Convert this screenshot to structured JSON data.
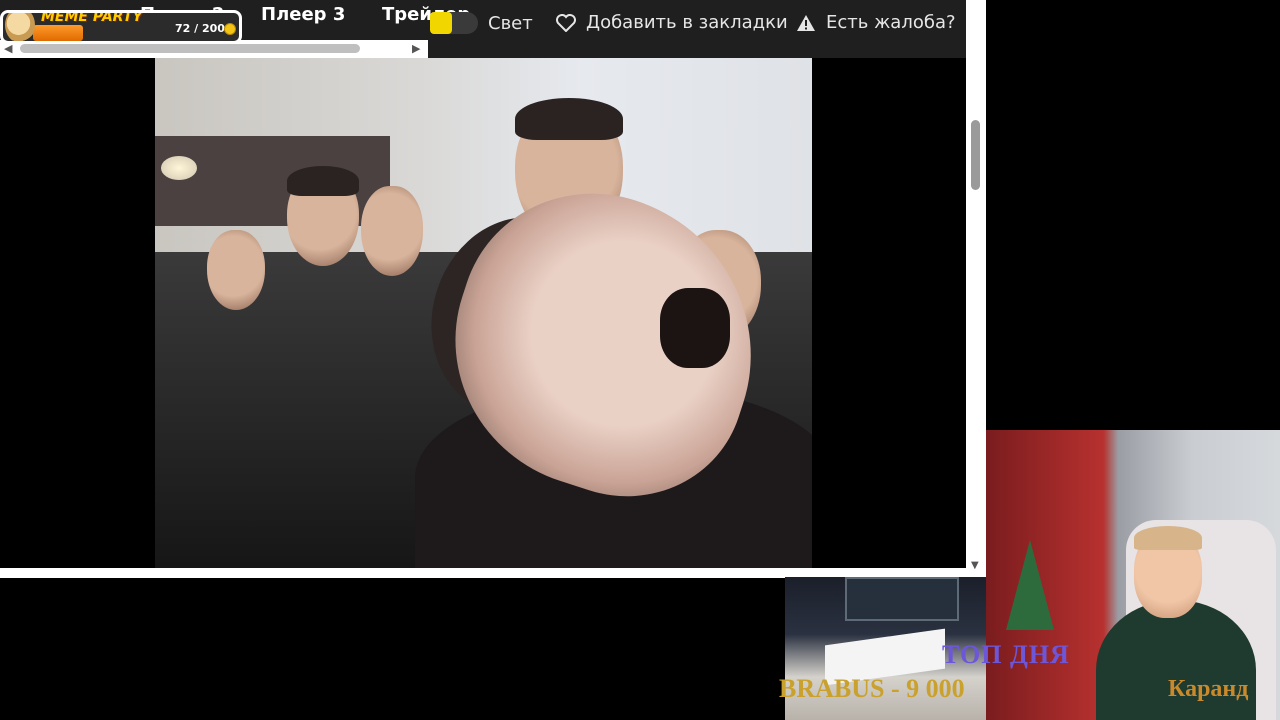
{
  "tabs": [
    {
      "label": "Плеер 2"
    },
    {
      "label": "Плеер 3"
    },
    {
      "label": "Трейлер"
    }
  ],
  "toolbar": {
    "light_label": "Свет",
    "bookmark_label": "Добавить в закладки",
    "complaint_label": "Есть жалоба?"
  },
  "meme_party": {
    "title": "MEME PARTY",
    "progress_text": "72 / 200",
    "progress_fraction": 0.36
  },
  "overlay": {
    "top_day_label": "ТОП ДНЯ",
    "top_donor": "BRABUS - 9 000",
    "ticker_text": "Каранд"
  },
  "icons": {
    "light_toggle": "toggle-icon",
    "bookmark": "heart-icon",
    "complaint": "warning-icon"
  },
  "colors": {
    "toolbar_bg": "#1f1f1f",
    "toggle_knob": "#f2d600",
    "meme_accent": "#ffcc00",
    "top_day": "#6d57d8",
    "donor": "#c9a12c"
  }
}
